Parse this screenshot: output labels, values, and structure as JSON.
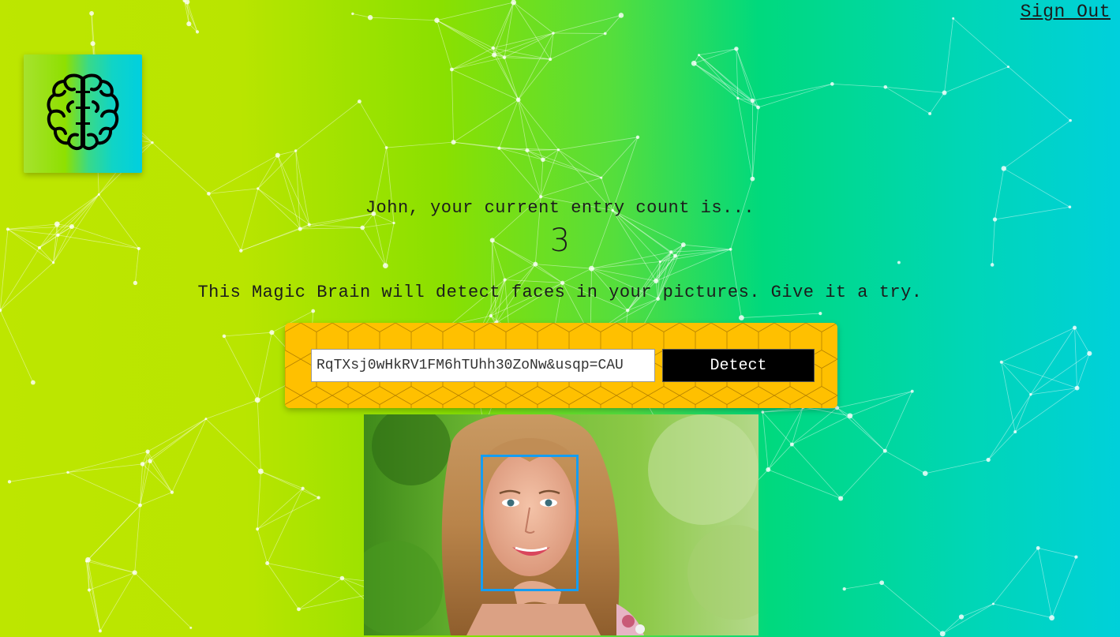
{
  "header": {
    "sign_out_label": "Sign Out"
  },
  "logo": {
    "icon": "brain-icon"
  },
  "rank": {
    "message": "John, your current entry count is...",
    "count": "3"
  },
  "intro": {
    "text": "This Magic Brain will detect faces in your pictures. Give it a try."
  },
  "form": {
    "url_value": "RqTXsj0wHkRV1FM6hTUhh30ZoNw&usqp=CAU",
    "detect_label": "Detect"
  },
  "colors": {
    "gradient_start": "#bde600",
    "gradient_end": "#00d0dc",
    "panel": "#ffc000",
    "face_box": "#149df2"
  }
}
